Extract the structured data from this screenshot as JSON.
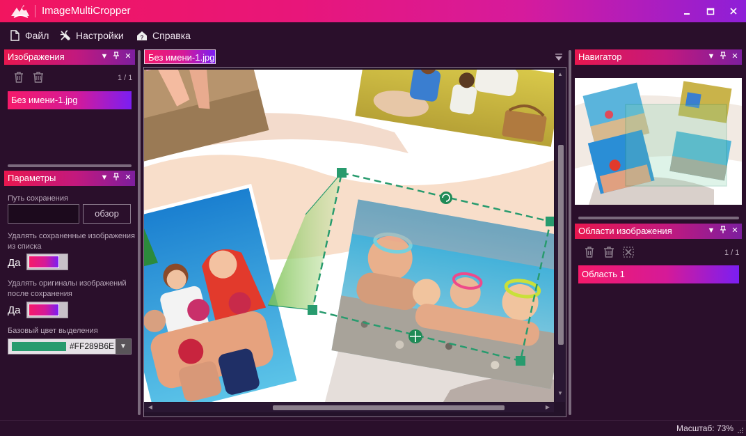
{
  "app": {
    "title": "ImageMultiCropper"
  },
  "window_controls": [
    "minimize-icon",
    "maximize-icon",
    "close-icon"
  ],
  "menu": {
    "file": "Файл",
    "settings": "Настройки",
    "help": "Справка"
  },
  "images_panel": {
    "title": "Изображения",
    "counter": "1 / 1",
    "items": [
      "Без имени-1.jpg"
    ]
  },
  "params_panel": {
    "title": "Параметры",
    "save_path_label": "Путь сохранения",
    "save_path_value": "",
    "browse_label": "обзор",
    "remove_saved_label_1": "Удалять сохраненные изображения",
    "remove_saved_label_2": "из списка",
    "remove_saved_value": "Да",
    "remove_originals_label_1": "Удалять оригиналы изображений",
    "remove_originals_label_2": "после сохранения",
    "remove_originals_value": "Да",
    "base_color_label": "Базовый цвет выделения",
    "base_color_value": "#FF289B6E"
  },
  "document": {
    "tab_label": "Без имени-1.jpg"
  },
  "navigator_panel": {
    "title": "Навигатор"
  },
  "regions_panel": {
    "title": "Области изображения",
    "counter": "1 / 1",
    "items": [
      "Область 1"
    ]
  },
  "status": {
    "zoom": "Масштаб: 73%"
  },
  "colors": {
    "accent_start": "#f51a6a",
    "accent_mid": "#d51a98",
    "accent_end": "#7b1ef2",
    "selection": "#289b6e",
    "background": "#2a0f2b"
  }
}
